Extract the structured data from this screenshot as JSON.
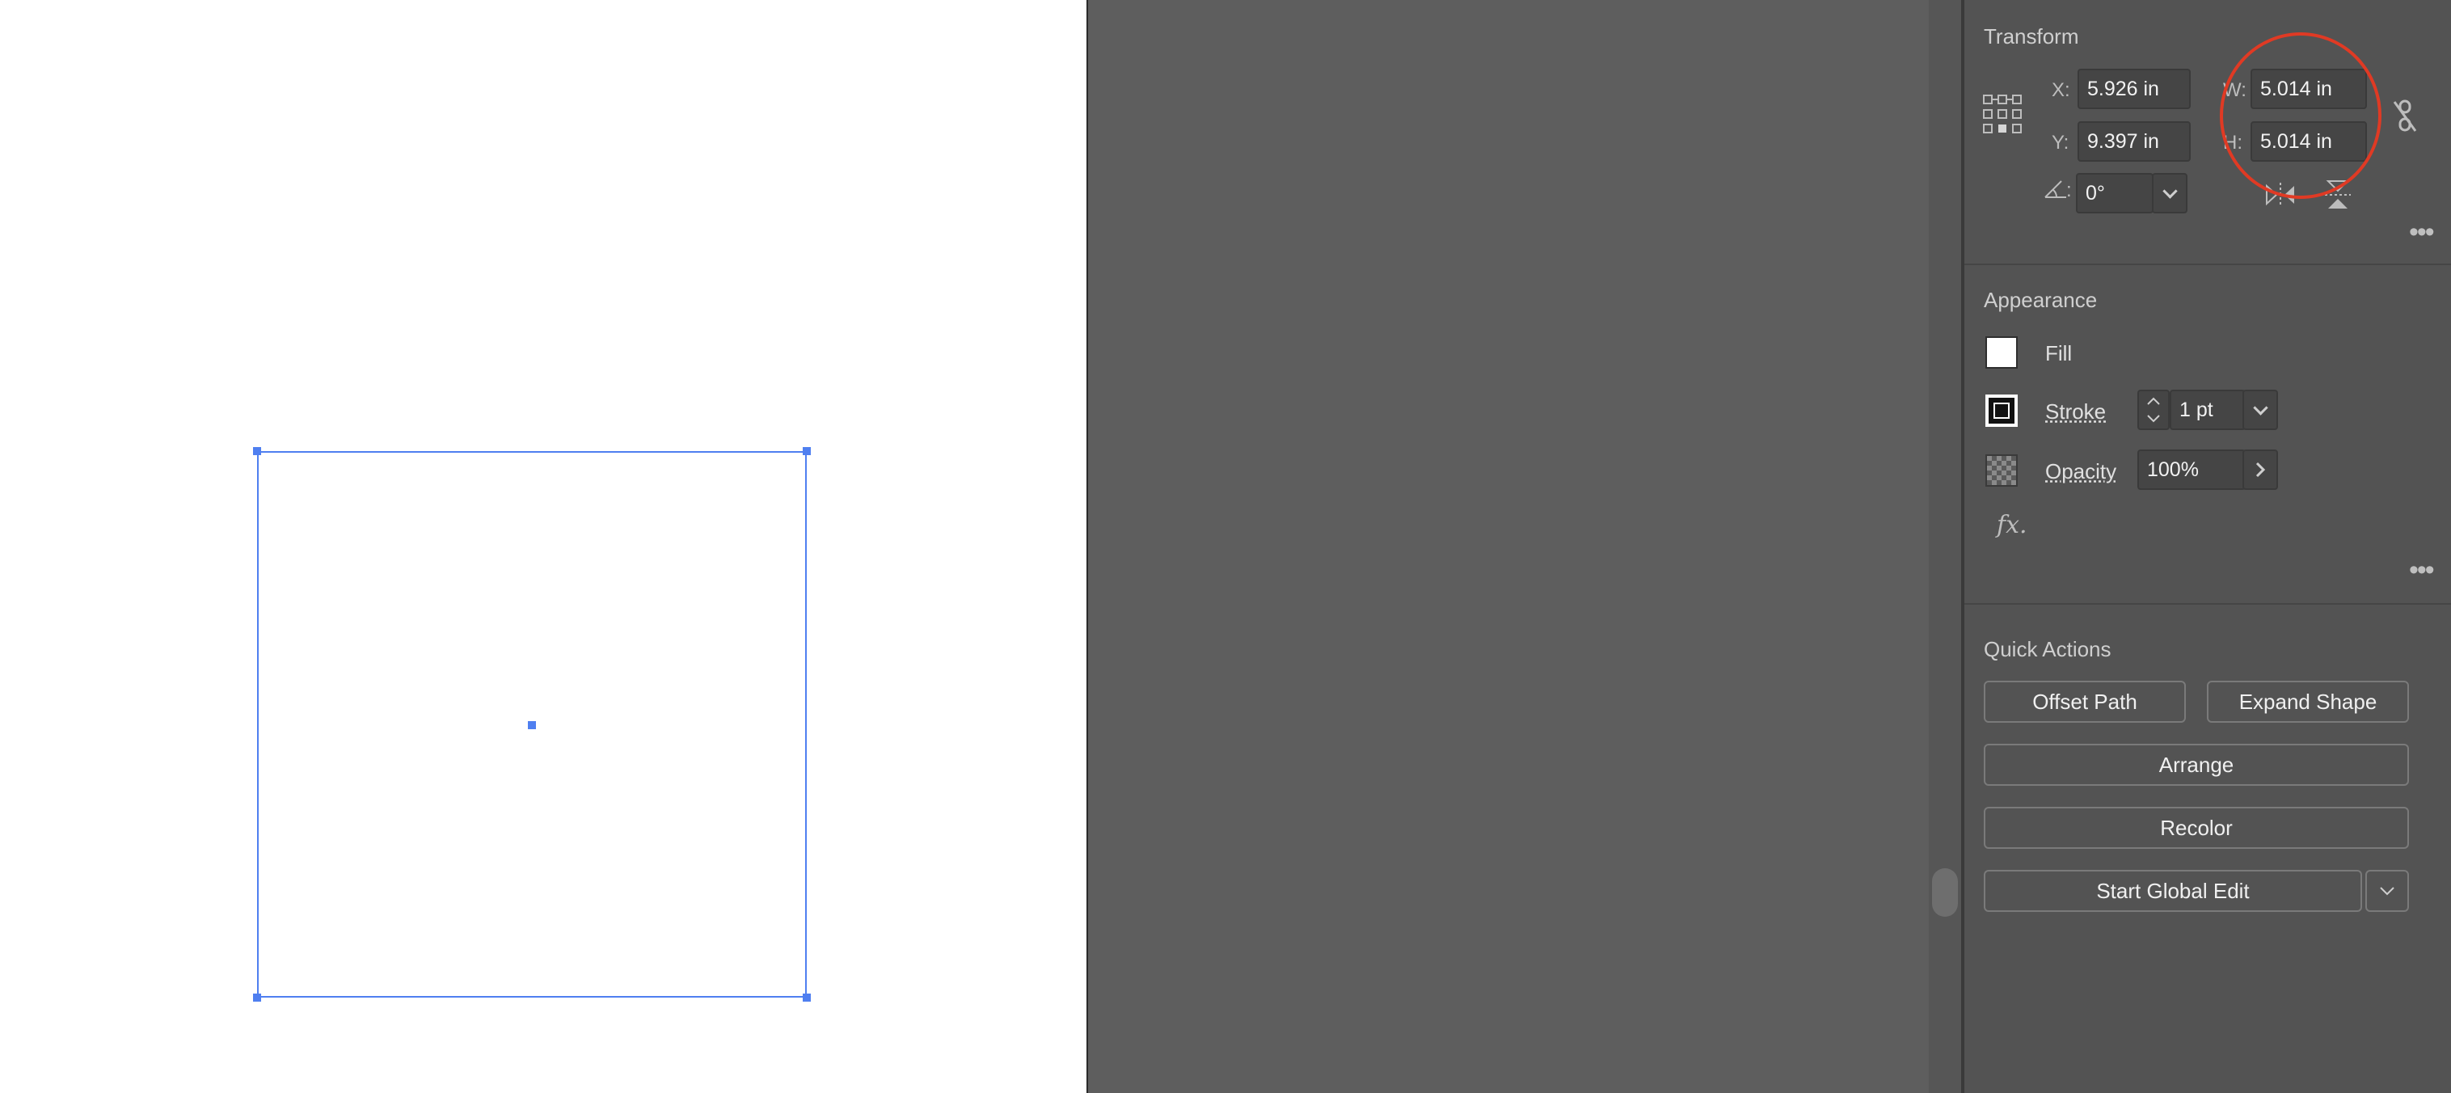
{
  "transform": {
    "title": "Transform",
    "x_label": "X:",
    "x_value": "5.926 in",
    "y_label": "Y:",
    "y_value": "9.397 in",
    "w_label": "W:",
    "w_value": "5.014 in",
    "h_label": "H:",
    "h_value": "5.014 in",
    "angle_label": ":",
    "angle_value": "0°"
  },
  "appearance": {
    "title": "Appearance",
    "fill_label": "Fill",
    "stroke_label": "Stroke",
    "stroke_weight": "1 pt",
    "opacity_label": "Opacity",
    "opacity_value": "100%",
    "fx_label": "fx."
  },
  "quick_actions": {
    "title": "Quick Actions",
    "offset_path": "Offset Path",
    "expand_shape": "Expand Shape",
    "arrange": "Arrange",
    "recolor": "Recolor",
    "start_global_edit": "Start Global Edit"
  },
  "colors": {
    "selection": "#4f7ff0",
    "annotation": "#e03a24",
    "panel_bg": "#535353",
    "pasteboard_bg": "#5e5e5e"
  },
  "icons": [
    "reference-point-icon",
    "link-proportions-icon",
    "angle-icon",
    "flip-horizontal-icon",
    "flip-vertical-icon",
    "more-options-icon",
    "chevron-down-icon",
    "chevron-right-icon"
  ]
}
